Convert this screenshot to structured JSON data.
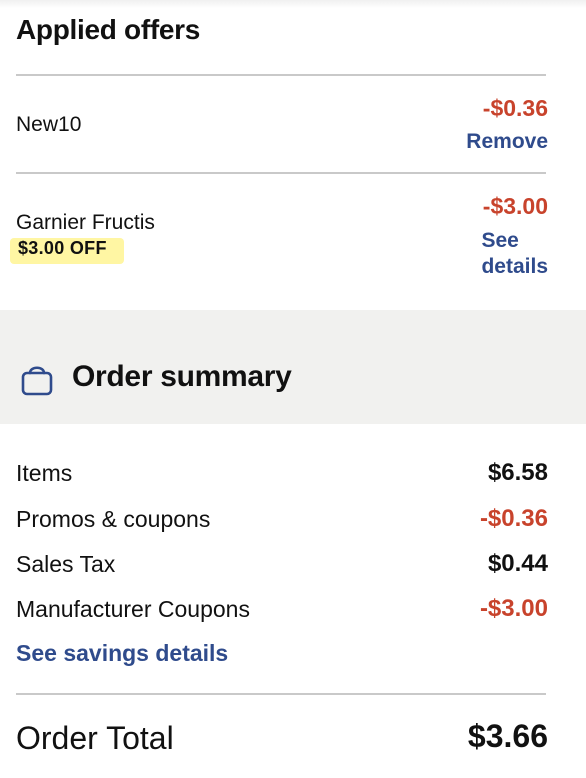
{
  "applied_offers": {
    "title": "Applied offers",
    "offers": [
      {
        "name": "New10",
        "amount": "-$0.36",
        "action": "Remove"
      },
      {
        "name": "Garnier Fructis",
        "tag": "$3.00 OFF",
        "amount": "-$3.00",
        "action_line1": "See",
        "action_line2": "details"
      }
    ]
  },
  "order_summary": {
    "title": "Order summary",
    "icon": "shopping-bag-icon",
    "rows": [
      {
        "label": "Items",
        "value": "$6.58"
      },
      {
        "label": "Promos & coupons",
        "value": "-$0.36"
      },
      {
        "label": "Sales Tax",
        "value": "$0.44"
      },
      {
        "label": "Manufacturer Coupons",
        "value": "-$3.00"
      }
    ],
    "savings_link": "See savings details",
    "total_label": "Order Total",
    "total_value": "$3.66"
  },
  "colors": {
    "discount": "#c8432c",
    "link": "#2f4b8c",
    "highlight": "#fff6a3",
    "band": "#f1f1ef"
  }
}
